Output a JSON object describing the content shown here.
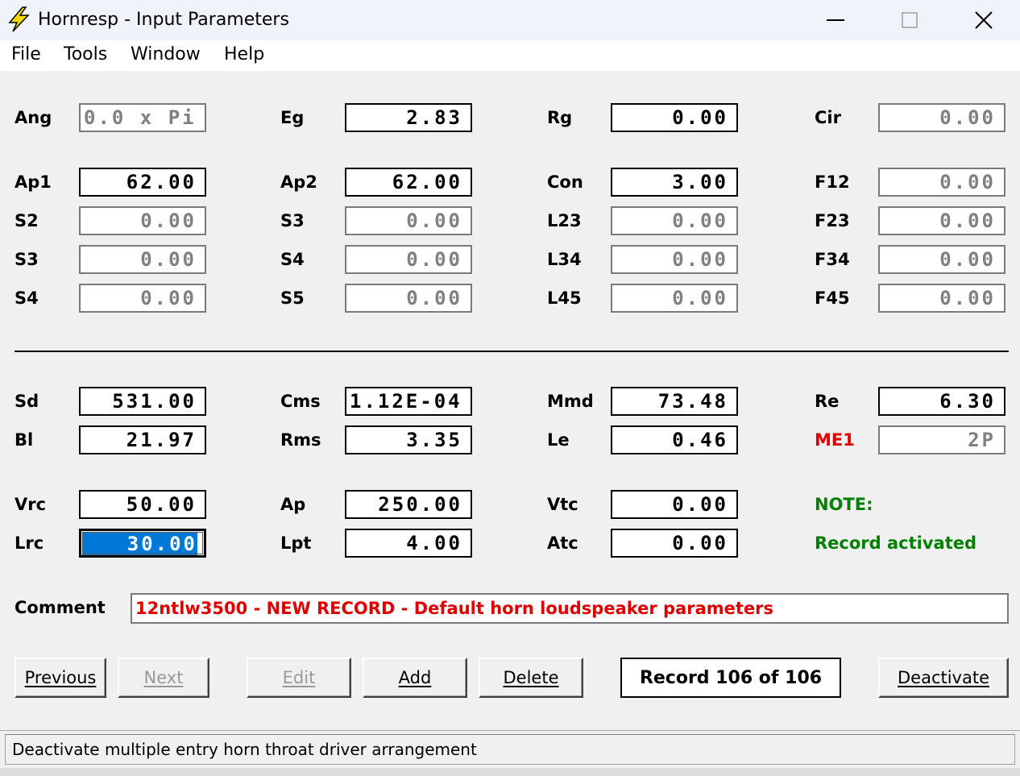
{
  "window": {
    "title": "Hornresp - Input Parameters",
    "minimize_glyph": "—",
    "close_glyph": "✕"
  },
  "menu": [
    "File",
    "Tools",
    "Window",
    "Help"
  ],
  "row1": [
    {
      "label": "Ang",
      "value": "0.0 x Pi"
    },
    {
      "label": "Eg",
      "value": "2.83"
    },
    {
      "label": "Rg",
      "value": "0.00"
    },
    {
      "label": "Cir",
      "value": "0.00"
    }
  ],
  "horn": [
    [
      {
        "label": "Ap1",
        "value": "62.00"
      },
      {
        "label": "Ap2",
        "value": "62.00"
      },
      {
        "label": "Con",
        "value": "3.00"
      },
      {
        "label": "F12",
        "value": "0.00"
      }
    ],
    [
      {
        "label": "S2",
        "value": "0.00"
      },
      {
        "label": "S3",
        "value": "0.00"
      },
      {
        "label": "L23",
        "value": "0.00"
      },
      {
        "label": "F23",
        "value": "0.00"
      }
    ],
    [
      {
        "label": "S3",
        "value": "0.00"
      },
      {
        "label": "S4",
        "value": "0.00"
      },
      {
        "label": "L34",
        "value": "0.00"
      },
      {
        "label": "F34",
        "value": "0.00"
      }
    ],
    [
      {
        "label": "S4",
        "value": "0.00"
      },
      {
        "label": "S5",
        "value": "0.00"
      },
      {
        "label": "L45",
        "value": "0.00"
      },
      {
        "label": "F45",
        "value": "0.00"
      }
    ]
  ],
  "driver": [
    [
      {
        "label": "Sd",
        "value": "531.00"
      },
      {
        "label": "Cms",
        "value": "1.12E-04"
      },
      {
        "label": "Mmd",
        "value": "73.48"
      },
      {
        "label": "Re",
        "value": "6.30"
      }
    ],
    [
      {
        "label": "Bl",
        "value": "21.97"
      },
      {
        "label": "Rms",
        "value": "3.35"
      },
      {
        "label": "Le",
        "value": "0.46"
      },
      {
        "label": "ME1",
        "value": "2P"
      }
    ]
  ],
  "chamber": [
    [
      {
        "label": "Vrc",
        "value": "50.00"
      },
      {
        "label": "Ap",
        "value": "250.00"
      },
      {
        "label": "Vtc",
        "value": "0.00"
      }
    ],
    [
      {
        "label": "Lrc",
        "value": "30.00"
      },
      {
        "label": "Lpt",
        "value": "4.00"
      },
      {
        "label": "Atc",
        "value": "0.00"
      }
    ]
  ],
  "note": {
    "heading": "NOTE:",
    "text": "Record activated"
  },
  "comment": {
    "label": "Comment",
    "value": "12ntlw3500 - NEW RECORD - Default horn loudspeaker parameters"
  },
  "buttons": {
    "previous": "Previous",
    "next": "Next",
    "edit": "Edit",
    "add": "Add",
    "delete": "Delete",
    "deactivate": "Deactivate"
  },
  "record_status": "Record 106 of 106",
  "status_text": "Deactivate multiple entry horn throat driver arrangement",
  "colors": {
    "note_green": "#008000",
    "warning_red": "#e00000",
    "selection_blue": "#0078d7"
  }
}
